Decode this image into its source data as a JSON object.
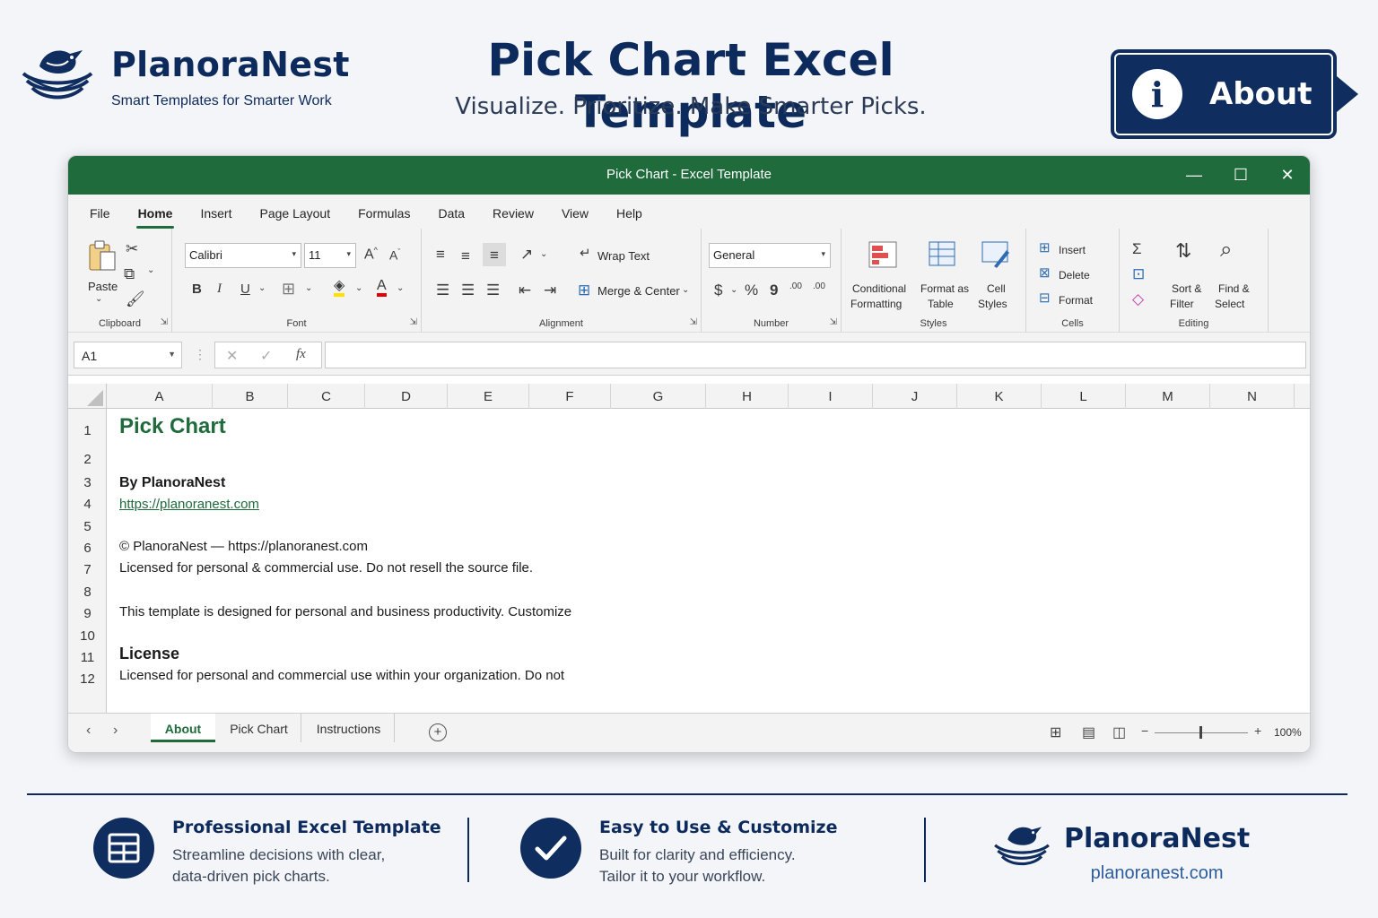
{
  "brand": {
    "name": "PlanoraNest",
    "tagline": "Smart Templates for Smarter Work"
  },
  "hero": {
    "title": "Pick Chart Excel Template",
    "subtitle": "Visualize. Prioritize. Make Smarter Picks."
  },
  "about_button": {
    "label": "About",
    "icon": "info-icon"
  },
  "window": {
    "title": "Pick Chart  -  Excel Template",
    "controls": {
      "minimize": "—",
      "maximize": "☐",
      "close": "✕"
    },
    "accent": "#1f6b3c"
  },
  "menu": [
    "File",
    "Home",
    "Insert",
    "Page Layout",
    "Formulas",
    "Data",
    "Review",
    "View",
    "Help"
  ],
  "menu_active": "Home",
  "ribbon": {
    "clipboard": {
      "paste": "Paste",
      "label": "Clipboard"
    },
    "font": {
      "name": "Calibri",
      "size": "11",
      "bold": "B",
      "italic": "I",
      "underline": "U",
      "grow": "A",
      "shrink": "A",
      "label": "Font"
    },
    "alignment": {
      "wrap": "Wrap Text",
      "merge": "Merge & Center",
      "label": "Alignment"
    },
    "number": {
      "format": "General",
      "currency": "$",
      "percent": "%",
      "comma": "9",
      "inc_decimal": ".00",
      "dec_decimal": ".00",
      "label": "Number"
    },
    "styles": {
      "conditional_1": "Conditional",
      "conditional_2": "Formatting",
      "format_table_1": "Format as",
      "format_table_2": "Table",
      "cell_styles_1": "Cell",
      "cell_styles_2": "Styles",
      "label": "Styles"
    },
    "cells": {
      "insert": "Insert",
      "delete": "Delete",
      "format": "Format",
      "label": "Cells"
    },
    "editing": {
      "sort_1": "Sort &",
      "sort_2": "Filter",
      "find_1": "Find &",
      "find_2": "Select",
      "label": "Editing"
    }
  },
  "formula_bar": {
    "name_box": "A1",
    "fx": "fx",
    "value": ""
  },
  "columns": [
    "A",
    "B",
    "C",
    "D",
    "E",
    "F",
    "G",
    "H",
    "I",
    "J",
    "K",
    "L",
    "M",
    "N"
  ],
  "rows": [
    "1",
    "2",
    "3",
    "4",
    "5",
    "6",
    "7",
    "8",
    "9",
    "10",
    "11",
    "12"
  ],
  "cells": {
    "a1": "Pick Chart",
    "a3": "By PlanoraNest",
    "a4": "https://planoranest.com",
    "a6": "© PlanoraNest — https://planoranest.com",
    "a7": "Licensed for personal & commercial use. Do not resell the source file.",
    "a9": "This template is designed for personal and business productivity. Customize",
    "a11": "License",
    "a12": "Licensed for personal and commercial use within your organization. Do not"
  },
  "sheet_tabs": [
    "About",
    "Pick Chart",
    "Instructions"
  ],
  "active_tab": "About",
  "status": {
    "zoom": "100%",
    "minus": "−",
    "plus": "+"
  },
  "features": [
    {
      "title": "Professional Excel Template",
      "line1": "Streamline decisions with clear,",
      "line2": "data-driven pick charts.",
      "icon": "table-icon"
    },
    {
      "title": "Easy to Use & Customize",
      "line1": "Built for clarity and efficiency.",
      "line2": "Tailor it to your workflow.",
      "icon": "checkmark-icon"
    }
  ],
  "footer_brand": {
    "name": "PlanoraNest",
    "url": "planoranest.com"
  },
  "colors": {
    "navy": "#0d2a5c",
    "excel_green": "#1f6b3c",
    "link": "#1f6b3c"
  }
}
